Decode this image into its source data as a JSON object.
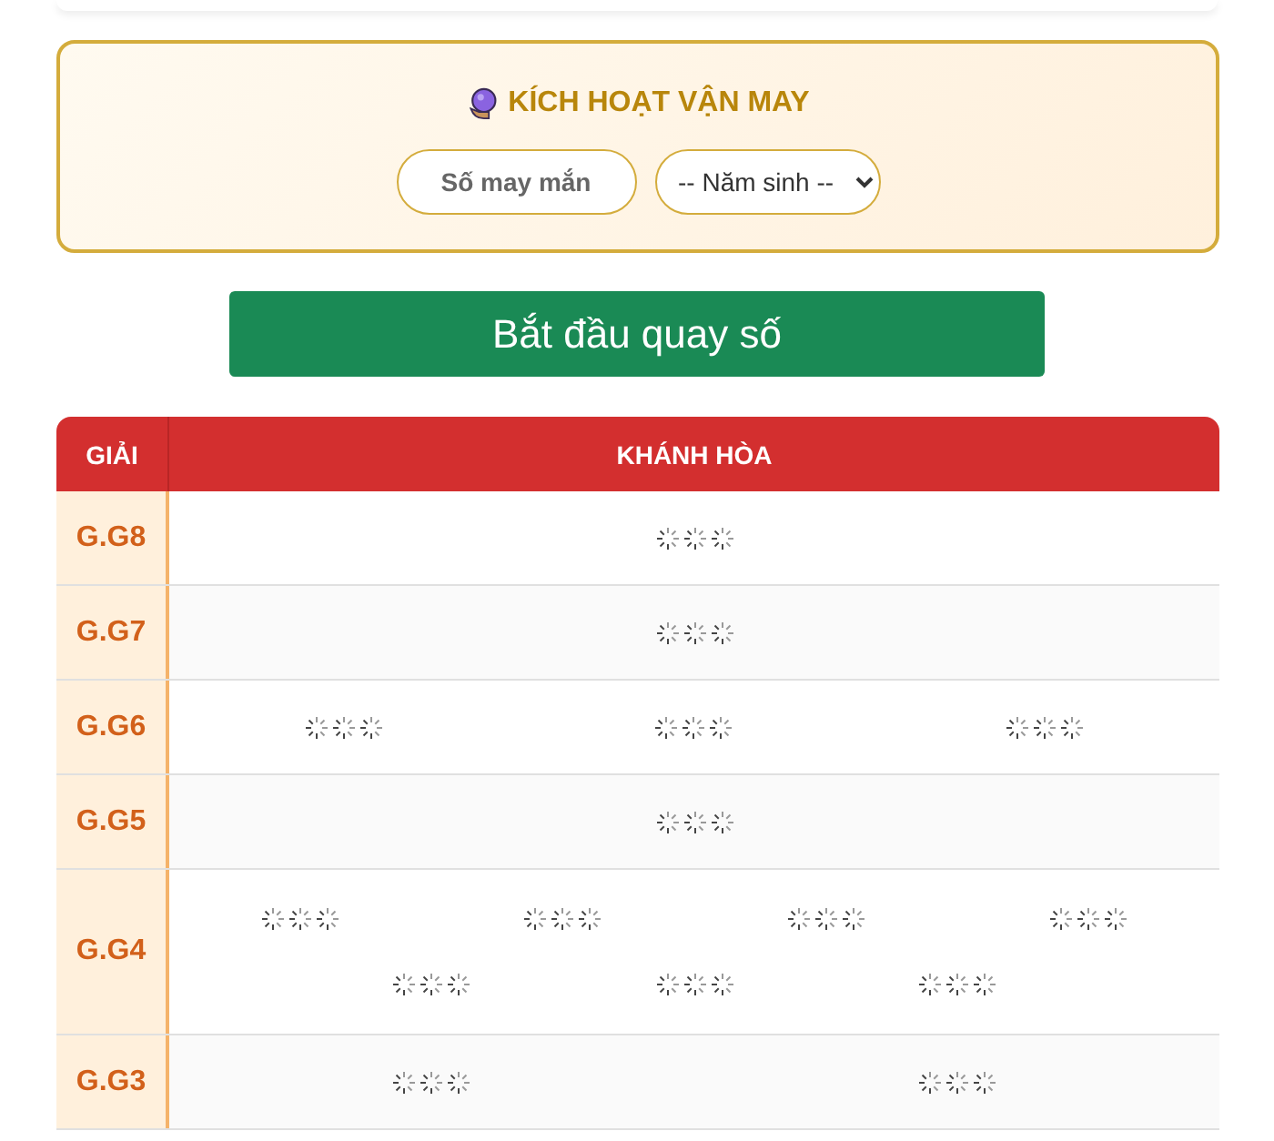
{
  "luck_panel": {
    "title": "KÍCH HOẠT VẬN MAY",
    "lucky_button": "Số may mắn",
    "year_select": {
      "value": "-- Năm sinh --"
    }
  },
  "start_button": "Bắt đầu quay số",
  "table": {
    "columns": [
      "GIẢI",
      "KHÁNH HÒA"
    ],
    "rows": [
      {
        "prize": "G.G8",
        "results": [
          {
            "kind": "loading"
          }
        ]
      },
      {
        "prize": "G.G7",
        "results": [
          {
            "kind": "loading"
          }
        ]
      },
      {
        "prize": "G.G6",
        "results": [
          {
            "kind": "loading"
          },
          {
            "kind": "loading"
          },
          {
            "kind": "loading"
          }
        ]
      },
      {
        "prize": "G.G5",
        "results": [
          {
            "kind": "loading"
          }
        ]
      },
      {
        "prize": "G.G4",
        "results": [
          {
            "kind": "loading"
          },
          {
            "kind": "loading"
          },
          {
            "kind": "loading"
          },
          {
            "kind": "loading"
          },
          {
            "kind": "loading"
          },
          {
            "kind": "loading"
          },
          {
            "kind": "loading"
          }
        ]
      },
      {
        "prize": "G.G3",
        "results": [
          {
            "kind": "loading"
          },
          {
            "kind": "loading"
          }
        ]
      }
    ]
  }
}
